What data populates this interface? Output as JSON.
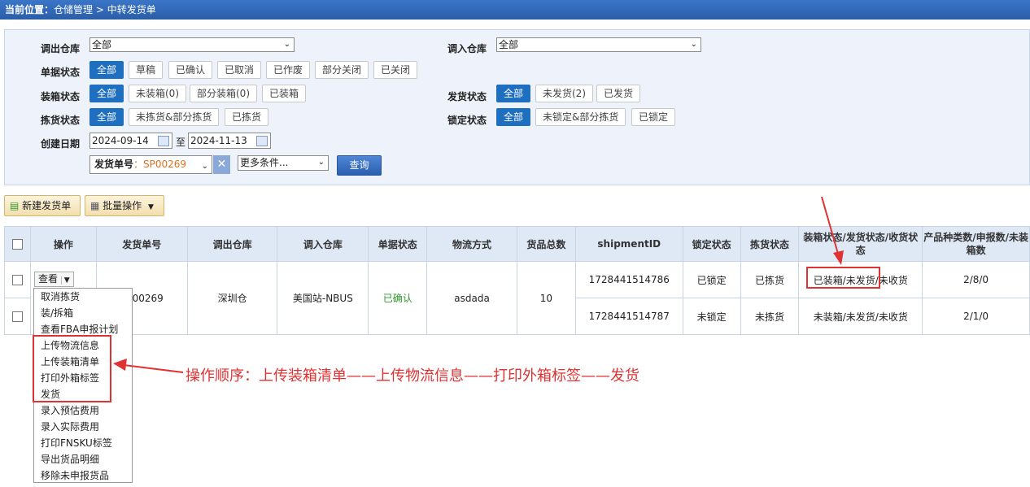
{
  "breadcrumb": {
    "label": "当前位置：",
    "path": "仓储管理 > 中转发货单"
  },
  "filters": {
    "out_wh_label": "调出仓库",
    "out_wh_value": "全部",
    "in_wh_label": "调入仓库",
    "in_wh_value": "全部",
    "doc_status_label": "单据状态",
    "doc_status_options": [
      "全部",
      "草稿",
      "已确认",
      "已取消",
      "已作废",
      "部分关闭",
      "已关闭"
    ],
    "pack_status_label": "装箱状态",
    "pack_status_options": [
      "全部",
      "未装箱(0)",
      "部分装箱(0)",
      "已装箱"
    ],
    "ship_status_label": "发货状态",
    "ship_status_options": [
      "全部",
      "未发货(2)",
      "已发货"
    ],
    "pick_status_label": "拣货状态",
    "pick_status_options": [
      "全部",
      "未拣货&部分拣货",
      "已拣货"
    ],
    "lock_status_label": "锁定状态",
    "lock_status_options": [
      "全部",
      "未锁定&部分拣货",
      "已锁定"
    ],
    "date_label": "创建日期",
    "date_from": "2024-09-14",
    "date_sep": "至",
    "date_to": "2024-11-13",
    "search_field_label": "发货单号",
    "search_field_sep": "：",
    "search_value": "SP00269",
    "more_conditions": "更多条件...",
    "query_button": "查询"
  },
  "toolbar": {
    "new_button": "新建发货单",
    "batch_button": "批量操作"
  },
  "table": {
    "headers": [
      "操作",
      "发货单号",
      "调出仓库",
      "调入仓库",
      "单据状态",
      "物流方式",
      "货品总数",
      "shipmentID",
      "锁定状态",
      "拣货状态",
      "装箱状态/发货状态/收货状态",
      "产品种类数/申报数/未装箱数"
    ],
    "row": {
      "action": "查看",
      "order_no": "SP00269",
      "out_wh": "深圳仓",
      "in_wh": "美国站-NBUS",
      "doc_status": "已确认",
      "logistics": "asdada",
      "total": "10"
    },
    "shipments": [
      {
        "id": "1728441514786",
        "lock": "已锁定",
        "pick": "已拣货",
        "status": "已装箱/未发货/未收货",
        "counts": "2/8/0"
      },
      {
        "id": "1728441514787",
        "lock": "未锁定",
        "pick": "未拣货",
        "status": "未装箱/未发货/未收货",
        "counts": "2/1/0"
      }
    ]
  },
  "menu": [
    "取消拣货",
    "装/拆箱",
    "查看FBA申报计划",
    "上传物流信息",
    "上传装箱清单",
    "打印外箱标签",
    "发货",
    "录入预估费用",
    "录入实际费用",
    "打印FNSKU标签",
    "导出货品明细",
    "移除未申报货品"
  ],
  "annotation": "操作顺序：上传装箱清单——上传物流信息——打印外箱标签——发货",
  "colors": {
    "accent": "#1f6fc1",
    "annotation_red": "#e03232",
    "confirmed_green": "#2e9a2e"
  }
}
